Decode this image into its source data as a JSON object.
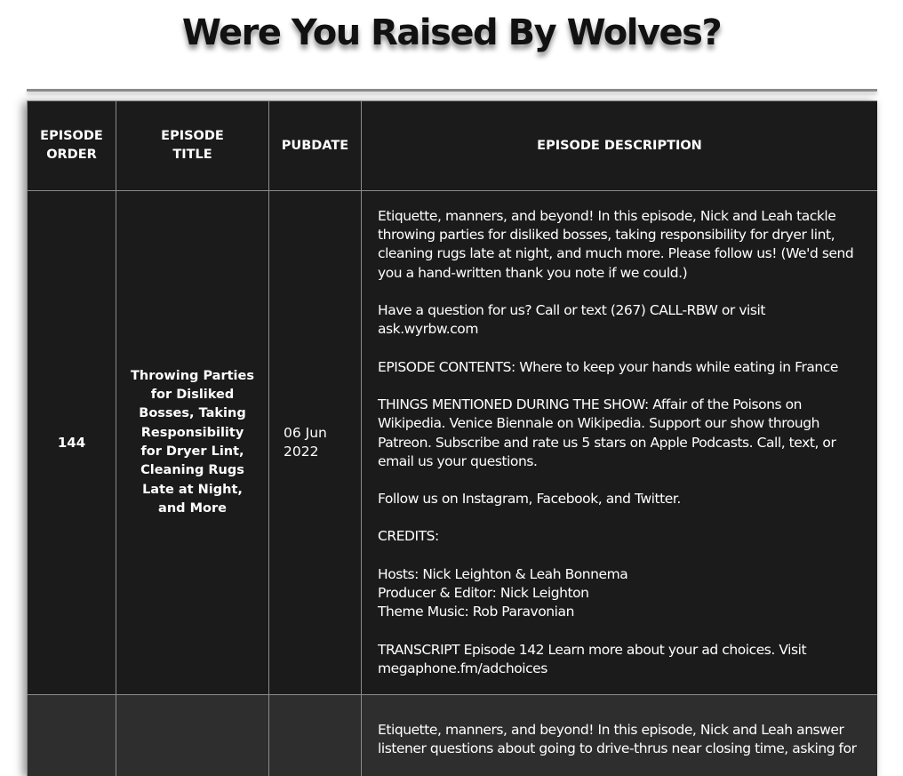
{
  "page": {
    "title": "Were You Raised By Wolves?"
  },
  "table": {
    "headers": {
      "order": "EPISODE ORDER",
      "title": "EPISODE TITLE",
      "pubdate": "PUBDATE",
      "description": "EPISODE DESCRIPTION"
    },
    "rows": [
      {
        "order": "144",
        "title": "Throwing Parties for Disliked Bosses, Taking Responsibility for Dryer Lint, Cleaning Rugs Late at Night, and More",
        "pubdate": "06 Jun 2022",
        "description": {
          "intro": "Etiquette, manners, and beyond! In this episode, Nick and Leah tackle throwing parties for disliked bosses, taking responsibility for dryer lint, cleaning rugs late at night, and much more. Please follow us! (We'd send you a hand-written thank you note if we could.)",
          "question": "Have a question for us? Call or text (267) CALL-RBW or visit ask.wyrbw.com",
          "contents": "EPISODE CONTENTS: Where to keep your hands while eating in France",
          "mentioned": "THINGS MENTIONED DURING THE SHOW: Affair of the Poisons on Wikipedia. Venice Biennale on Wikipedia. Support our show through Patreon. Subscribe and rate us 5 stars on Apple Podcasts. Call, text, or email us your questions.",
          "follow": "Follow us on Instagram, Facebook, and Twitter.",
          "credits_heading": "CREDITS:",
          "hosts": "Hosts: Nick Leighton & Leah Bonnema",
          "producer": "Producer & Editor: Nick Leighton",
          "theme": "Theme Music: Rob Paravonian",
          "transcript": "TRANSCRIPT Episode 142 Learn more about your ad choices. Visit megaphone.fm/adchoices"
        }
      },
      {
        "order": "",
        "title": "",
        "pubdate": "",
        "description": {
          "intro": "Etiquette, manners, and beyond! In this episode, Nick and Leah answer listener questions about going to drive-thrus near closing time, asking for"
        }
      }
    ]
  }
}
